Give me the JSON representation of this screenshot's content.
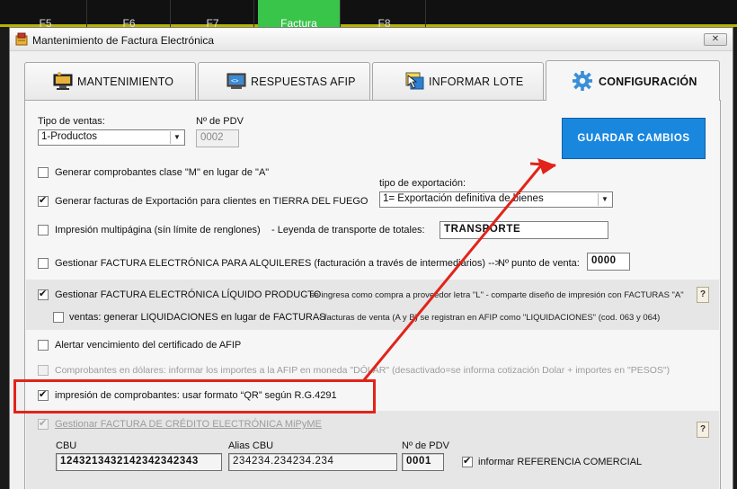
{
  "background_app": {
    "fkeys": [
      "F5",
      "F6",
      "F7",
      "Factura",
      "F8"
    ]
  },
  "window": {
    "title": "Mantenimiento de Factura Electrónica",
    "close_label": "✕"
  },
  "tabs": [
    {
      "label": "MANTENIMIENTO",
      "icon": "computer-icon"
    },
    {
      "label": "RESPUESTAS AFIP",
      "icon": "terminal-icon"
    },
    {
      "label": "INFORMAR LOTE",
      "icon": "cursor-window-icon"
    },
    {
      "label": "CONFIGURACIÓN",
      "icon": "gear-icon",
      "active": true
    }
  ],
  "config": {
    "tipo_ventas_label": "Tipo de ventas:",
    "tipo_ventas_value": "1-Productos",
    "pdv_label": "Nº de PDV",
    "pdv_value": "0002",
    "save_button": "GUARDAR CAMBIOS",
    "opt_clase_m": "Generar comprobantes clase \"M\" en lugar de \"A\"",
    "opt_exportacion": "Generar facturas de Exportación para clientes en TIERRA DEL FUEGO",
    "tipo_exportacion_label": "tipo de exportación:",
    "tipo_exportacion_value": "1= Exportación definitiva de bienes",
    "opt_multipagina": "Impresión multipágina (sín límite de renglones)",
    "leyenda_label": "-  Leyenda de transporte de totales:",
    "leyenda_value": "TRANSPORTE",
    "opt_alquileres": "Gestionar FACTURA ELECTRÓNICA PARA ALQUILERES (facturación a través de intermediarios) -->",
    "punto_venta_label": "Nº punto de venta:",
    "punto_venta_value": "0000",
    "opt_liquido": "Gestionar FACTURA ELECTRÓNICA LÍQUIDO PRODUCTO",
    "liquido_note": "-  se ingresa como compra a proveedor letra \"L\" - comparte diseño de impresión con FACTURAS \"A\"",
    "opt_liquidaciones": "ventas: generar LIQUIDACIONES en lugar de FACTURAS",
    "liquidaciones_note": "-  facturas de venta (A y B) se registran en AFIP como \"LIQUIDACIONES\" (cod. 063 y 064)",
    "opt_certificado": "Alertar vencimiento del certificado de AFIP",
    "opt_dolares": "Comprobantes en dólares: informar los importes a la AFIP en moneda \"DÓLAR\" (desactivado=se informa cotización Dolar + importes en  \"PESOS\")",
    "opt_qr": "impresión de comprobantes: usar formato “QR” según R.G.4291",
    "opt_mipyme": "Gestionar FACTURA DE CRÉDITO ELECTRÓNICA MiPyME",
    "cbu_label": "CBU",
    "cbu_value": "1243213432142342342343",
    "alias_label": "Alias CBU",
    "alias_value": "234234.234234.234",
    "mipyme_pdv_label": "Nº de PDV",
    "mipyme_pdv_value": "0001",
    "opt_referencia": "informar REFERENCIA COMERCIAL",
    "help_label": "?"
  },
  "colors": {
    "save_button": "#1a87df",
    "annotation": "#e2231a",
    "highlight_band": "#e6e6e6"
  }
}
